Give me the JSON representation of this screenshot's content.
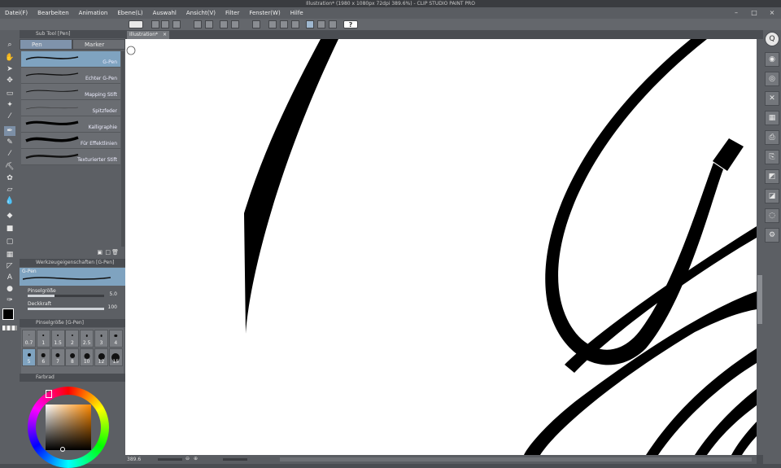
{
  "window": {
    "title": "Illustration* (1980 x 1080px 72dpi 389.6%) - CLIP STUDIO PAINT PRO"
  },
  "menu": [
    "Datei(F)",
    "Bearbeiten",
    "Animation",
    "Ebene(L)",
    "Auswahl",
    "Ansicht(V)",
    "Filter",
    "Fenster(W)",
    "Hilfe"
  ],
  "document_tab": {
    "label": "Illustration*",
    "close": "×"
  },
  "sub_tool": {
    "header": "Sub Tool [Pen]",
    "tabs": [
      "Pen",
      "Marker"
    ],
    "brushes": [
      "G-Pen",
      "Echter G-Pen",
      "Mapping Stift",
      "Spitzfeder",
      "Kalligraphie",
      "Für Effektlinien",
      "Texturierter Stift"
    ]
  },
  "tool_property": {
    "header": "Werkzeugeigenschaften [G-Pen]",
    "selected": "G-Pen",
    "brush_size": {
      "label": "Pinselgröße",
      "value": "5.0",
      "fill": 0.35
    },
    "opacity": {
      "label": "Deckkraft",
      "value": "100",
      "fill": 1.0
    }
  },
  "brush_size_panel": {
    "header": "Pinselgröße [G-Pen]",
    "sizes": [
      "0.7",
      "1",
      "1.5",
      "2",
      "2.5",
      "3",
      "4",
      "5",
      "6",
      "7",
      "8",
      "10",
      "12",
      "15"
    ]
  },
  "color_wheel": {
    "header": "Farbrad"
  },
  "status": {
    "zoom": "389.6"
  },
  "colors": {
    "accent": "#7fa3c0",
    "panel": "#5c5f64",
    "canvas": "#ffffff"
  }
}
